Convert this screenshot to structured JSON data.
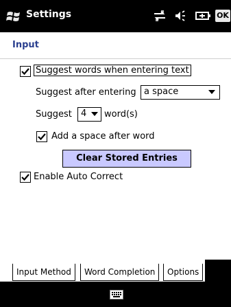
{
  "titlebar": {
    "title": "Settings",
    "ok_label": "OK",
    "icons": [
      "windows-logo-icon",
      "connectivity-icon",
      "volume-icon",
      "battery-icon"
    ]
  },
  "header": {
    "title": "Input"
  },
  "options": {
    "suggest_words_label": "Suggest words when entering text",
    "suggest_words_checked": true,
    "suggest_after_label": "Suggest after entering",
    "suggest_after_value": "a space",
    "suggest_label": "Suggest",
    "suggest_count_value": "4",
    "words_label": "word(s)",
    "add_space_label": "Add a space after word",
    "add_space_checked": true,
    "clear_button_label": "Clear Stored Entries",
    "auto_correct_label": "Enable Auto Correct",
    "auto_correct_checked": true
  },
  "tabs": [
    {
      "label": "Input Method",
      "active": false
    },
    {
      "label": "Word Completion",
      "active": true
    },
    {
      "label": "Options",
      "active": false
    }
  ],
  "bottombar": {
    "icon": "keyboard-icon"
  },
  "colors": {
    "header_text": "#2a3f8f",
    "button_bg": "#c9c9ff"
  }
}
